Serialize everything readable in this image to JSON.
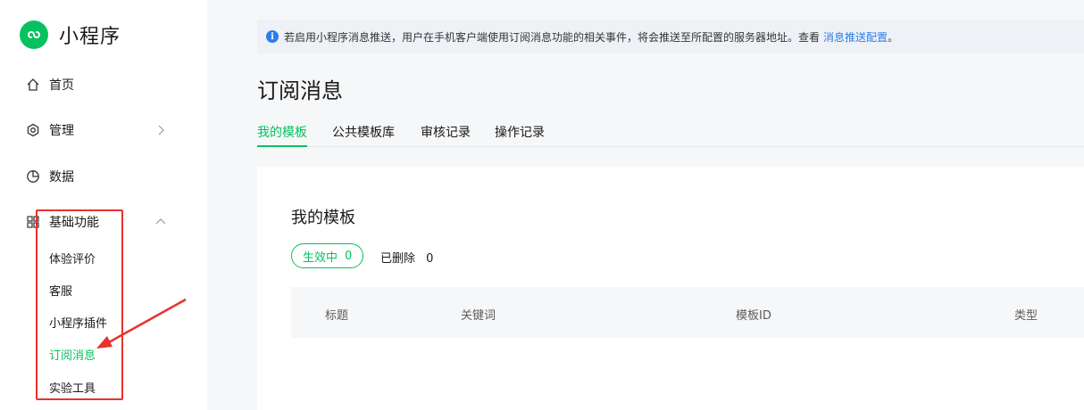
{
  "app": {
    "title": "小程序"
  },
  "sidebar": {
    "items": [
      {
        "label": "首页",
        "icon": "home-icon"
      },
      {
        "label": "管理",
        "icon": "settings-icon"
      },
      {
        "label": "数据",
        "icon": "chart-icon"
      },
      {
        "label": "基础功能",
        "icon": "grid-icon"
      }
    ],
    "sub_items": [
      {
        "label": "体验评价"
      },
      {
        "label": "客服"
      },
      {
        "label": "小程序插件"
      },
      {
        "label": "订阅消息",
        "active": true
      },
      {
        "label": "实验工具"
      }
    ]
  },
  "notice": {
    "text": "若启用小程序消息推送，用户在手机客户端使用订阅消息功能的相关事件，将会推送至所配置的服务器地址。查看",
    "link": "消息推送配置",
    "suffix": "。",
    "info_glyph": "i"
  },
  "page": {
    "title": "订阅消息"
  },
  "tabs": [
    {
      "label": "我的模板",
      "active": true
    },
    {
      "label": "公共模板库"
    },
    {
      "label": "审核记录"
    },
    {
      "label": "操作记录"
    }
  ],
  "card": {
    "title": "我的模板",
    "filters": {
      "active_label": "生效中",
      "active_count": "0",
      "deleted_label": "已删除",
      "deleted_count": "0"
    },
    "table_headers": [
      "标题",
      "关键词",
      "模板ID",
      "类型"
    ]
  },
  "colors": {
    "brand": "#07c160",
    "link": "#2b7de9",
    "annotation": "#e8322c"
  }
}
